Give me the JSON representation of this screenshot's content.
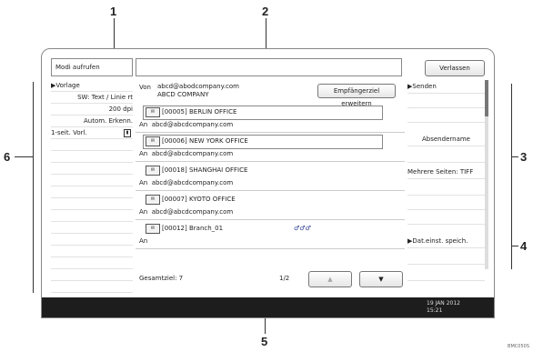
{
  "callouts": [
    "1",
    "2",
    "3",
    "4",
    "5",
    "6"
  ],
  "header": {
    "module_title": "Modi aufrufen",
    "exit_label": "Verlassen"
  },
  "left_panel": {
    "rows": [
      "▶Vorlage",
      "SW: Text / Linie rt",
      "200 dpi",
      "Autom. Erkenn.",
      "1-seit. Vorl."
    ]
  },
  "sender": {
    "from_label": "Von",
    "email": "abcd@abodcompany.com",
    "company": "ABCD COMPANY",
    "extend_button": "Empfängerziel erweitern"
  },
  "recipients": [
    {
      "code": "[00005]",
      "name": "BERLIN OFFICE",
      "to_label": "An",
      "address": "abcd@abcdcompany.com"
    },
    {
      "code": "[00006]",
      "name": "NEW YORK OFFICE",
      "to_label": "An",
      "address": "abcd@abcdcompany.com"
    },
    {
      "code": "[00018]",
      "name": "SHANGHAI OFFICE",
      "to_label": "An",
      "address": "abcd@abcdcompany.com"
    },
    {
      "code": "[00007]",
      "name": "KYOTO OFFICE",
      "to_label": "An",
      "address": "abcd@abcdcompany.com"
    },
    {
      "code": "[00012]",
      "name": "Branch_01",
      "to_label": "An",
      "address": "",
      "badge": "♂♂♂"
    }
  ],
  "footer": {
    "total": "Gesamtziel: 7",
    "page": "1/2",
    "prev": "▲",
    "next": "▼"
  },
  "right_panel": {
    "send": "▶Senden",
    "sender_name": "Absendername",
    "multi_page": "Mehrere Seiten: TIFF",
    "save_file": "▶Dat.einst. speich."
  },
  "clock": {
    "line1": "19 JAN 2012",
    "line2": "15:21"
  },
  "ref_code": "BMC050S"
}
